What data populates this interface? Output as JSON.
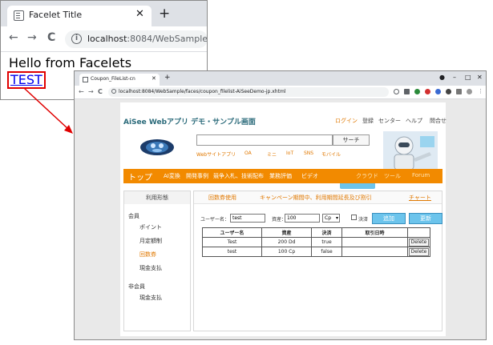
{
  "browser1": {
    "tab_title": "Facelet Title",
    "tab_close": "✕",
    "newtab": "+",
    "nav_back": "←",
    "nav_forward": "→",
    "nav_reload": "C",
    "info": "i",
    "url_host": "localhost",
    "url_path": ":8084/WebSample/",
    "heading": "Hello from Facelets",
    "link": "TEST"
  },
  "browser2": {
    "tab_title": "Coupon_FileList-cn",
    "tab_close": "✕",
    "newtab": "+",
    "win_min": "–",
    "win_max": "□",
    "win_close": "✕",
    "nav_back": "←",
    "nav_forward": "→",
    "nav_reload": "C",
    "url": "localhost:8084/WebSample/faces/coupon_filelist-AiSeeDemo-jp.xhtml"
  },
  "site": {
    "title": "AiSee Webアプリ デモ・サンプル画面",
    "login": "ログイン",
    "register": "登録",
    "center": "センター",
    "help": "ヘルプ",
    "contact": "問合せ",
    "search_button": "サーチ",
    "sublinks": [
      "Webサイトアプリ",
      "OA",
      "ミニ",
      "IoT",
      "SNS",
      "モバイル"
    ],
    "badge": "TEST",
    "menu": {
      "top": "トップ",
      "items": [
        "AI変換",
        "開発事例",
        "競争入札、技術配布",
        "業務評価",
        "ビデオ"
      ],
      "right": [
        "クラウド",
        "ツール",
        "Forum"
      ]
    },
    "side": {
      "heading": "利用形態",
      "group1": "会員",
      "items1": [
        "ポイント",
        "月定額制",
        "回数券",
        "現金支払"
      ],
      "group2": "非会員",
      "items2": [
        "現金支払"
      ]
    },
    "main": {
      "heading": "回数券使用",
      "notice": "キャンペーン期間中、利用期間延長及び割引",
      "chart_link": "チャート",
      "user_label": "ユーザー名：",
      "user_value": "test",
      "asset_label": "資産：",
      "asset_value": "100",
      "currency": "Cp",
      "settled_label": "決済",
      "add_button": "追加",
      "update_button": "更新",
      "table": {
        "headers": [
          "ユーザー名",
          "資産",
          "決済",
          "取引日時",
          ""
        ],
        "rows": [
          [
            "Test",
            "200 Dd",
            "true",
            "",
            "Delete"
          ],
          [
            "test",
            "100 Cp",
            "false",
            "",
            "Delete"
          ]
        ]
      }
    }
  },
  "colors": {
    "accent_orange": "#f28a00",
    "button_blue": "#6cc4ec",
    "highlight_red": "#e00000",
    "title_teal": "#2a6a7a"
  }
}
